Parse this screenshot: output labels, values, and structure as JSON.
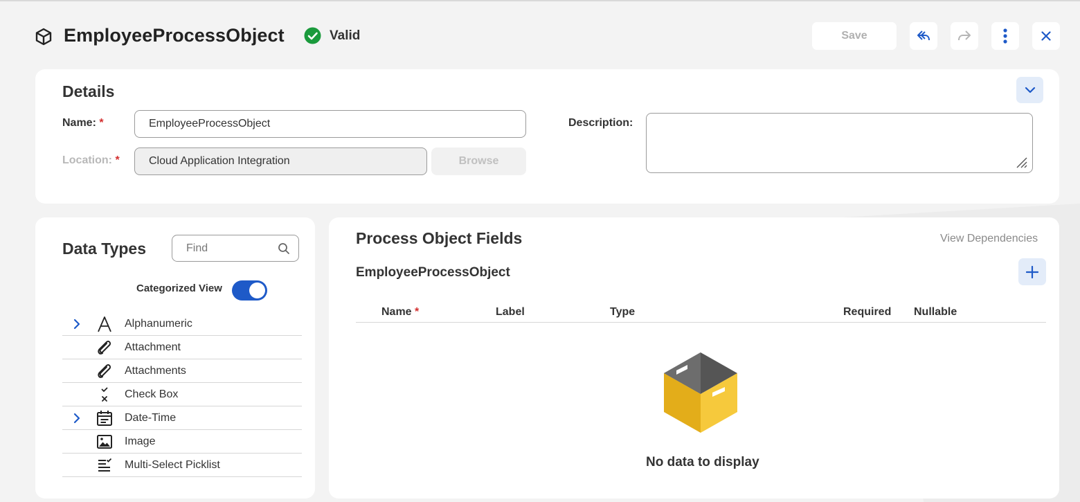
{
  "header": {
    "title": "EmployeeProcessObject",
    "status": "Valid",
    "save_label": "Save"
  },
  "details": {
    "title": "Details",
    "name_label": "Name:",
    "name_value": "EmployeeProcessObject",
    "location_label": "Location:",
    "location_value": "Cloud Application Integration",
    "browse_label": "Browse",
    "description_label": "Description:",
    "description_value": "",
    "required_mark": "*"
  },
  "data_types": {
    "title": "Data Types",
    "find_placeholder": "Find",
    "categorized_label": "Categorized View",
    "categorized_on": true,
    "items": [
      {
        "label": "Alphanumeric",
        "icon": "alphanumeric-icon",
        "expandable": true
      },
      {
        "label": "Attachment",
        "icon": "paperclip-icon",
        "expandable": false
      },
      {
        "label": "Attachments",
        "icon": "paperclip-icon",
        "expandable": false
      },
      {
        "label": "Check Box",
        "icon": "checkbox-icon",
        "expandable": false
      },
      {
        "label": "Date-Time",
        "icon": "calendar-icon",
        "expandable": true
      },
      {
        "label": "Image",
        "icon": "image-icon",
        "expandable": false
      },
      {
        "label": "Multi-Select Picklist",
        "icon": "multi-select-icon",
        "expandable": false
      }
    ]
  },
  "fields": {
    "title": "Process Object Fields",
    "view_dependencies": "View Dependencies",
    "object_name": "EmployeeProcessObject",
    "columns": [
      "Name",
      "Label",
      "Type",
      "Required",
      "Nullable"
    ],
    "empty_text": "No data to display"
  },
  "colors": {
    "accent": "#1e5ac8",
    "valid_green": "#1a9a3c",
    "required_red": "#d32f2f",
    "box_yellow": "#e3ad1a"
  }
}
